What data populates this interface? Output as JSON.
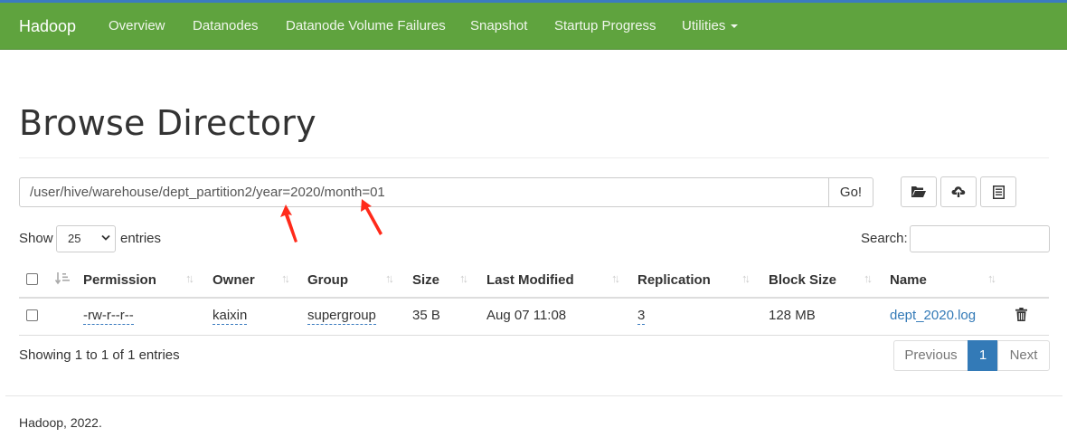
{
  "navbar": {
    "brand": "Hadoop",
    "items": [
      "Overview",
      "Datanodes",
      "Datanode Volume Failures",
      "Snapshot",
      "Startup Progress",
      "Utilities"
    ]
  },
  "page_title": "Browse Directory",
  "path_bar": {
    "value": "/user/hive/warehouse/dept_partition2/year=2020/month=01",
    "go_label": "Go!"
  },
  "toolbar_icons": [
    "folder-open-icon",
    "cloud-upload-icon",
    "list-icon"
  ],
  "show_entries": {
    "show_label": "Show",
    "selected": "25",
    "entries_label": "entries"
  },
  "search": {
    "label": "Search:",
    "value": ""
  },
  "table": {
    "columns": [
      "Permission",
      "Owner",
      "Group",
      "Size",
      "Last Modified",
      "Replication",
      "Block Size",
      "Name"
    ],
    "rows": [
      {
        "permission": "-rw-r--r--",
        "owner": "kaixin",
        "group": "supergroup",
        "size": "35 B",
        "last_modified": "Aug 07 11:08",
        "replication": "3",
        "block_size": "128 MB",
        "name": "dept_2020.log"
      }
    ]
  },
  "info": "Showing 1 to 1 of 1 entries",
  "pagination": {
    "previous": "Previous",
    "current": "1",
    "next": "Next"
  },
  "footer": "Hadoop, 2022.",
  "colors": {
    "navbar": "#5fa33e",
    "accent": "#337ab7",
    "annotation_arrow": "#ff2a1a"
  }
}
